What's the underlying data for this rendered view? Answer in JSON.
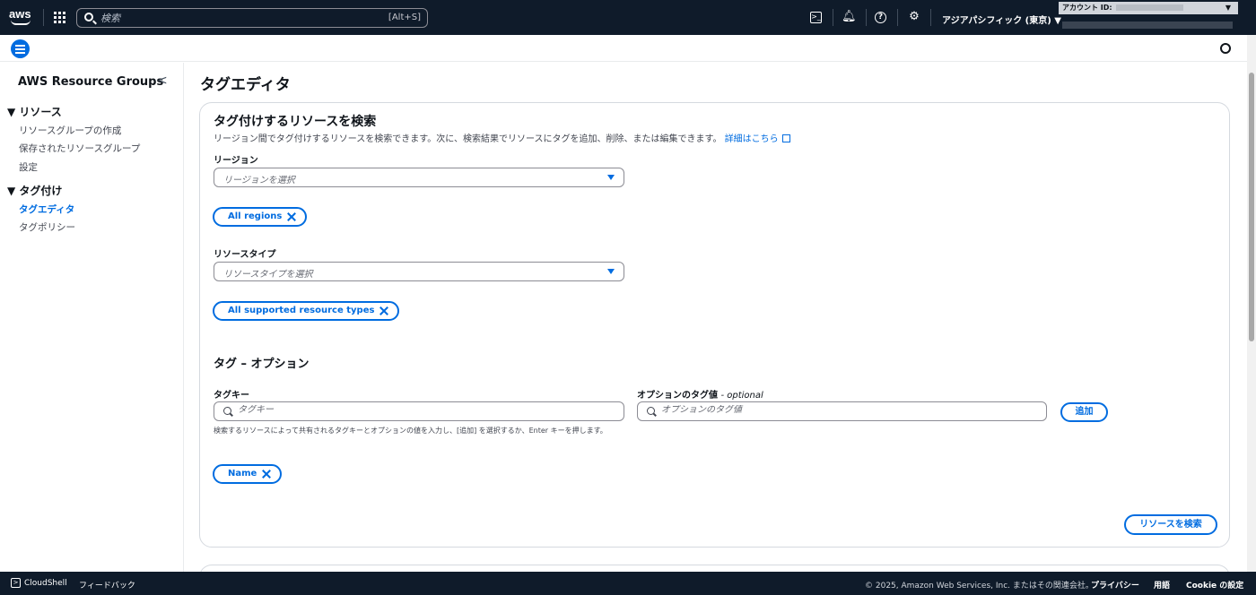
{
  "topnav": {
    "logo": "aws",
    "search_placeholder": "検索",
    "search_shortcut": "[Alt+S]",
    "region": "アジアパシフィック (東京) ▼",
    "account_label": "アカウント ID:"
  },
  "sidebar": {
    "title": "AWS Resource Groups",
    "sections": [
      {
        "label": "▼ リソース",
        "items": [
          "リソースグループの作成",
          "保存されたリソースグループ",
          "設定"
        ]
      },
      {
        "label": "▼ タグ付け",
        "items": [
          "タグエディタ",
          "タグポリシー"
        ]
      }
    ],
    "active_item": "タグエディタ"
  },
  "main": {
    "page_title": "タグエディタ",
    "panel": {
      "heading": "タグ付けするリソースを検索",
      "description": "リージョン間でタグ付けするリソースを検索できます。次に、検索結果でリソースにタグを追加、削除、または編集できます。",
      "learn_more": "詳細はこちら",
      "region_label": "リージョン",
      "region_placeholder": "リージョンを選択",
      "region_token": "All regions",
      "resource_type_label": "リソースタイプ",
      "resource_type_placeholder": "リソースタイプを選択",
      "resource_type_token": "All supported resource types",
      "tags_heading": "タグ – オプション",
      "tag_key_label": "タグキー",
      "tag_key_placeholder": "タグキー",
      "tag_value_label": "オプションのタグ値",
      "tag_value_optional": "- optional",
      "tag_value_placeholder": "オプションのタグ値",
      "add_button": "追加",
      "hint": "検索するリソースによって共有されるタグキーとオプションの値を入力し、[追加] を選択するか、Enter キーを押します。",
      "tag_token": "Name",
      "search_button": "リソースを検索"
    }
  },
  "footer": {
    "cloudshell": "CloudShell",
    "feedback": "フィードバック",
    "copyright": "© 2025, Amazon Web Services, Inc. またはその関連会社。",
    "privacy": "プライバシー",
    "terms": "用語",
    "cookie": "Cookie の設定"
  }
}
